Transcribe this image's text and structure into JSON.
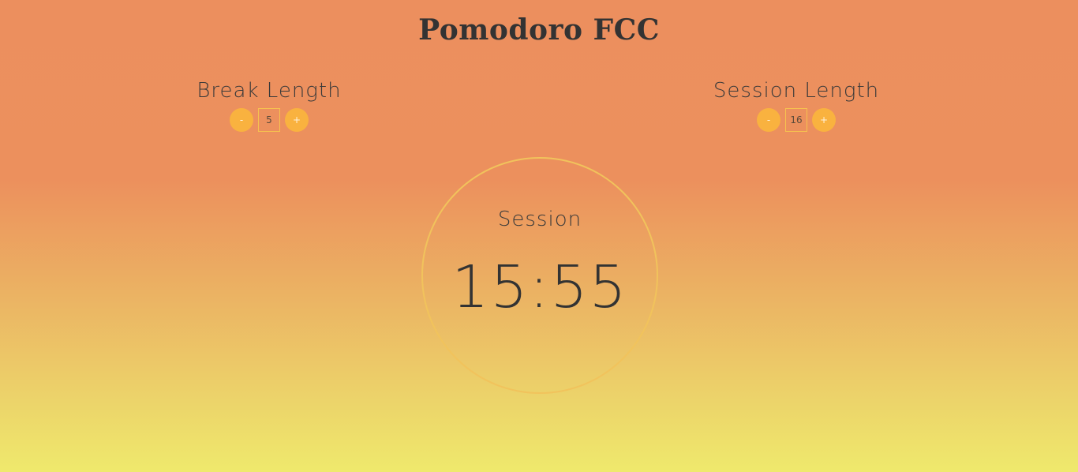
{
  "app": {
    "title": "Pomodoro FCC"
  },
  "break_control": {
    "label": "Break Length",
    "decrement_label": "-",
    "value": "5",
    "increment_label": "+"
  },
  "session_control": {
    "label": "Session Length",
    "decrement_label": "-",
    "value": "16",
    "increment_label": "+"
  },
  "timer": {
    "mode_label": "Session",
    "time": "15:55"
  },
  "colors": {
    "background_top": "#ec8f5e",
    "background_bottom": "#efe96c",
    "button_accent": "#f9b23f",
    "circle_border": "#f1c35c",
    "text": "#333333"
  }
}
